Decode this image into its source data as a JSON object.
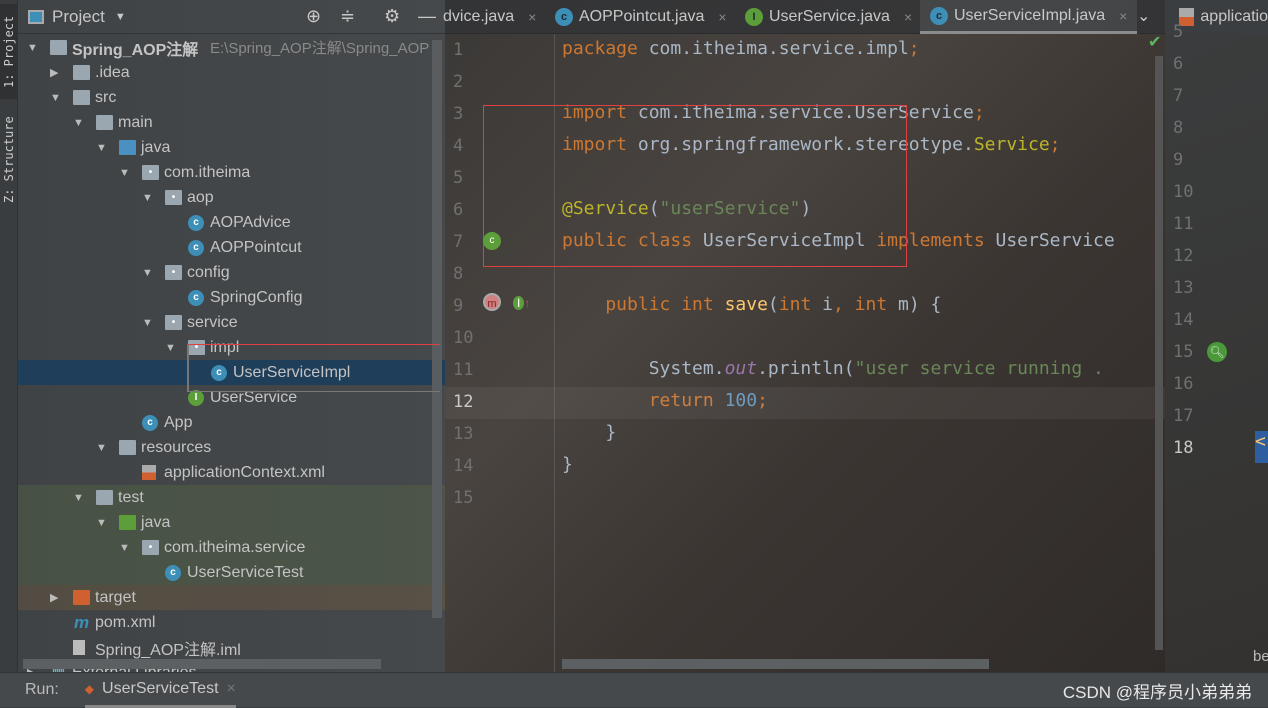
{
  "left_stripe": {
    "project_tab": "1: Project",
    "structure_tab": "Z: Structure"
  },
  "project": {
    "title": "Project",
    "root": "Spring_AOP注解",
    "root_path": "E:\\Spring_AOP注解\\Spring_AOP",
    "items": [
      {
        "label": ".idea",
        "level": 1,
        "arrow": "collapsed",
        "icon": "folder"
      },
      {
        "label": "src",
        "level": 1,
        "arrow": "expanded",
        "icon": "folder"
      },
      {
        "label": "main",
        "level": 2,
        "arrow": "expanded",
        "icon": "folder"
      },
      {
        "label": "java",
        "level": 3,
        "arrow": "expanded",
        "icon": "source-folder"
      },
      {
        "label": "com.itheima",
        "level": 4,
        "arrow": "expanded",
        "icon": "package"
      },
      {
        "label": "aop",
        "level": 5,
        "arrow": "expanded",
        "icon": "package"
      },
      {
        "label": "AOPAdvice",
        "level": 6,
        "icon": "class"
      },
      {
        "label": "AOPPointcut",
        "level": 6,
        "icon": "class"
      },
      {
        "label": "config",
        "level": 5,
        "arrow": "expanded",
        "icon": "package"
      },
      {
        "label": "SpringConfig",
        "level": 6,
        "icon": "class"
      },
      {
        "label": "service",
        "level": 5,
        "arrow": "expanded",
        "icon": "package"
      },
      {
        "label": "impl",
        "level": 6,
        "arrow": "expanded",
        "icon": "package"
      },
      {
        "label": "UserServiceImpl",
        "level": 7,
        "icon": "class",
        "selected": true
      },
      {
        "label": "UserService",
        "level": 6,
        "icon": "interface"
      },
      {
        "label": "App",
        "level": 4,
        "icon": "class"
      },
      {
        "label": "resources",
        "level": 3,
        "arrow": "expanded",
        "icon": "resources-folder"
      },
      {
        "label": "applicationContext.xml",
        "level": 4,
        "icon": "xml"
      },
      {
        "label": "test",
        "level": 2,
        "arrow": "expanded",
        "icon": "folder"
      },
      {
        "label": "java",
        "level": 3,
        "arrow": "expanded",
        "icon": "test-folder"
      },
      {
        "label": "com.itheima.service",
        "level": 4,
        "arrow": "expanded",
        "icon": "package"
      },
      {
        "label": "UserServiceTest",
        "level": 5,
        "icon": "class"
      },
      {
        "label": "target",
        "level": 1,
        "arrow": "collapsed",
        "icon": "excluded-folder"
      },
      {
        "label": "pom.xml",
        "level": 1,
        "icon": "maven"
      },
      {
        "label": "Spring_AOP注解.iml",
        "level": 1,
        "icon": "iml"
      },
      {
        "label": "External Libraries",
        "level": 0,
        "arrow": "collapsed",
        "icon": "libraries"
      }
    ]
  },
  "tabs": [
    {
      "label": "dvice.java",
      "icon": "class"
    },
    {
      "label": "AOPPointcut.java",
      "icon": "class"
    },
    {
      "label": "UserService.java",
      "icon": "interface"
    },
    {
      "label": "UserServiceImpl.java",
      "icon": "class",
      "active": true
    },
    {
      "label": "applicatio",
      "icon": "xml"
    }
  ],
  "code": [
    [
      [
        "package ",
        "k"
      ],
      [
        "com.itheima.service.impl",
        ""
      ],
      [
        ";",
        "k"
      ]
    ],
    [],
    [
      [
        "import ",
        "k"
      ],
      [
        "com.itheima.service.UserService",
        ""
      ],
      [
        ";",
        "k"
      ]
    ],
    [
      [
        "import ",
        "k"
      ],
      [
        "org.springframework.stereotype.",
        ""
      ],
      [
        "Service",
        "a"
      ],
      [
        ";",
        "k"
      ]
    ],
    [],
    [
      [
        "@Service",
        "a"
      ],
      [
        "(",
        ""
      ],
      [
        "\"userService\"",
        "s"
      ],
      [
        ")",
        ""
      ]
    ],
    [
      [
        "public class ",
        "k"
      ],
      [
        "UserServiceImpl ",
        ""
      ],
      [
        "implements ",
        "k"
      ],
      [
        "UserService",
        ""
      ]
    ],
    [],
    [
      [
        "    public int ",
        "k"
      ],
      [
        "save",
        "f"
      ],
      [
        "(",
        ""
      ],
      [
        "int ",
        "k"
      ],
      [
        "i",
        ""
      ],
      [
        ", ",
        "k"
      ],
      [
        "int ",
        "k"
      ],
      [
        "m) {",
        ""
      ]
    ],
    [],
    [
      [
        "        System.",
        ""
      ],
      [
        "out",
        "o"
      ],
      [
        ".println(",
        ""
      ],
      [
        "\"user service running .",
        "s"
      ]
    ],
    [
      [
        "        return ",
        "k"
      ],
      [
        "100",
        "n"
      ],
      [
        ";",
        "k"
      ]
    ],
    [
      [
        "    }",
        ""
      ]
    ],
    [
      [
        "}",
        ""
      ]
    ],
    []
  ],
  "right_editor": {
    "line_numbers": [
      "5",
      "6",
      "7",
      "8",
      "9",
      "10",
      "11",
      "12",
      "13",
      "14",
      "15",
      "16",
      "17",
      "18"
    ],
    "fragment_18": "<",
    "bottom_fragment": "be"
  },
  "bottom": {
    "run_label": "Run:",
    "run_tab": "UserServiceTest",
    "watermark": "CSDN @程序员小弟弟弟"
  }
}
